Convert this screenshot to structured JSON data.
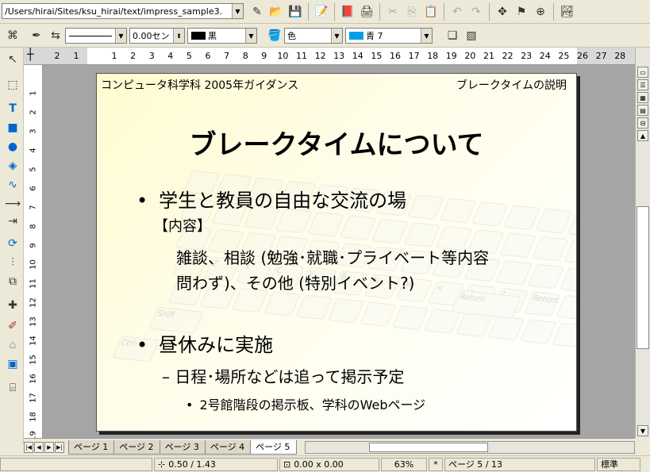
{
  "toolbar1": {
    "url": "/Users/hirai/Sites/ksu_hirai/text/impress_sample3."
  },
  "toolbar2": {
    "line_width": "0.00セン",
    "line_color": "黒",
    "fill_style": "色",
    "fill_color": "青 7",
    "colors": {
      "line_swatch": "#000000",
      "fill_swatch": "#00a0e6"
    }
  },
  "hruler": {
    "ticks": [
      "2",
      "1",
      "1",
      "2",
      "3",
      "4",
      "5",
      "6",
      "7",
      "8",
      "9",
      "10",
      "11",
      "12",
      "13",
      "14",
      "15",
      "16",
      "17",
      "18",
      "19",
      "20",
      "21",
      "22",
      "23",
      "24",
      "25",
      "26",
      "27",
      "28"
    ]
  },
  "vruler": {
    "ticks": [
      "1",
      "2",
      "3",
      "4",
      "5",
      "6",
      "7",
      "8",
      "9",
      "10",
      "11",
      "12",
      "13",
      "14",
      "15",
      "16",
      "17",
      "18",
      "19"
    ]
  },
  "slide": {
    "header_left": "コンピュータ科学科 2005年ガイダンス",
    "header_right": "ブレークタイムの説明",
    "title": "ブレークタイムについて",
    "bullet1": "学生と教員の自由な交流の場",
    "bullet1_sub": "【内容】",
    "bullet1_body_line1": "雑談、相談 (勉強･就職･プライベート等内容",
    "bullet1_body_line2": "問わず)、その他 (特別イベント?)",
    "bullet2": "昼休みに実施",
    "bullet2_sub": "– 日程･場所などは追って掲示予定",
    "bullet2_sub2": "2号館階段の掲示板、学科のWebページ",
    "bg_keys": [
      "Shift",
      "Z",
      "X",
      "C",
      "V",
      "B",
      "N",
      "M",
      "<",
      ">",
      "?",
      "Return",
      "Shift",
      "Ctrl"
    ]
  },
  "tabs": {
    "items": [
      "ページ 1",
      "ページ 2",
      "ページ 3",
      "ページ 4",
      "ページ 5"
    ],
    "active_index": 4
  },
  "status": {
    "position": "0.50 / 1.43",
    "size": "0.00 x 0.00",
    "zoom": "63%",
    "modified": "*",
    "page": "ページ 5 / 13",
    "style": "標準"
  }
}
